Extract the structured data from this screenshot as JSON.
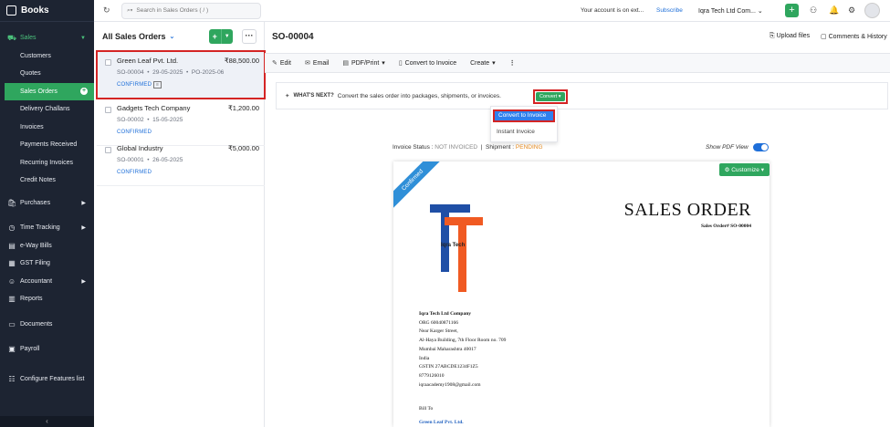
{
  "sidebar": {
    "brand": "Books",
    "sales_label": "Sales",
    "sales_items": [
      "Customers",
      "Quotes",
      "Sales Orders",
      "Delivery Challans",
      "Invoices",
      "Payments Received",
      "Recurring Invoices",
      "Credit Notes"
    ],
    "other_items": [
      "Purchases",
      "Time Tracking",
      "e-Way Bills",
      "GST Filing",
      "Accountant",
      "Reports",
      "Documents",
      "Payroll",
      "Configure Features list"
    ]
  },
  "topbar": {
    "search_placeholder": "Search in Sales Orders ( / )",
    "account_msg": "Your account is on ext...",
    "subscribe": "Subscribe",
    "org_name": "Iqra Tech Ltd Com..."
  },
  "list": {
    "title": "All Sales Orders",
    "items": [
      {
        "name": "Green Leaf Pvt. Ltd.",
        "amount": "₹88,500.00",
        "number": "SO-00004",
        "date": "29-05-2025",
        "ref": "PO-2025-06",
        "status": "CONFIRMED"
      },
      {
        "name": "Gadgets Tech Company",
        "amount": "₹1,200.00",
        "number": "SO-00002",
        "date": "15-05-2025",
        "ref": "",
        "status": "CONFIRMED"
      },
      {
        "name": "Global Industry",
        "amount": "₹5,000.00",
        "number": "SO-00001",
        "date": "26-05-2025",
        "ref": "",
        "status": "CONFIRMED"
      }
    ]
  },
  "detail": {
    "title": "SO-00004",
    "upload_files": "Upload files",
    "comments": "Comments & History",
    "toolbar": {
      "edit": "Edit",
      "email": "Email",
      "pdf": "PDF/Print",
      "convert": "Convert to Invoice",
      "create": "Create"
    },
    "whats_next_label": "WHAT'S NEXT?",
    "whats_next_text": "Convert the sales order into packages, shipments, or invoices.",
    "convert_btn": "Convert",
    "menu": [
      "Convert to Invoice",
      "Instant Invoice"
    ],
    "invoice_status_label": "Invoice Status :",
    "invoice_status": "NOT INVOICED",
    "shipment_label": "Shipment :",
    "shipment_status": "PENDING",
    "show_pdf": "Show PDF View"
  },
  "document": {
    "ribbon": "Confirmed",
    "customize": "Customize",
    "title": "SALES ORDER",
    "order_no": "Sales Order# SO-00004",
    "logo_text": "Iqra  Tech",
    "company": {
      "name": "Iqra Tech Ltd Company",
      "lines": [
        "ORG 60040871166",
        "Near Karger Street,",
        "Al-Haya Building, 7th Floor Room no. 709",
        "Mumbai Maharashtra 40017",
        "India",
        "GSTIN 27ABCDE1234F1Z5",
        "8779126010",
        "iqraacademy1908@gmail.com"
      ]
    },
    "bill_to": "Bill To",
    "bill_to_name": "Green Leaf Pvt. Ltd."
  },
  "colors": {
    "sidebar": "#1d2432",
    "accent_green": "#2fa65e",
    "link_blue": "#1e6fd9",
    "highlight_red": "#d42424",
    "logo_blue": "#1f4fa6",
    "logo_orange": "#f05a22"
  },
  "icons": [
    "refresh-icon",
    "search-icon",
    "plus-icon",
    "people-icon",
    "bell-icon",
    "gear-icon",
    "upload-icon",
    "comment-icon",
    "edit-icon",
    "email-icon",
    "pdf-icon",
    "doc-icon"
  ]
}
